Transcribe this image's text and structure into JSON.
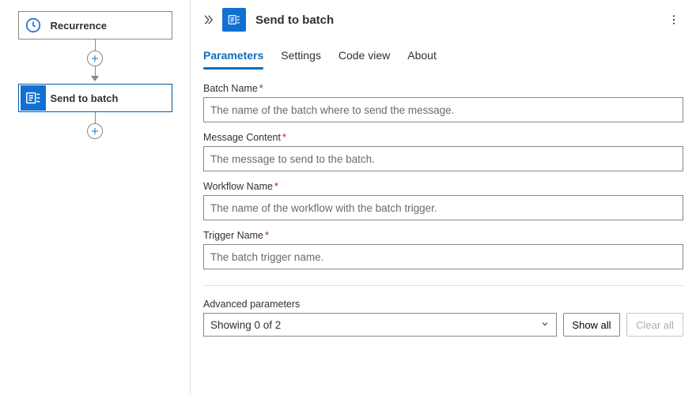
{
  "canvas": {
    "nodes": [
      {
        "label": "Recurrence",
        "icon": "recurrence-icon"
      },
      {
        "label": "Send to batch",
        "icon": "batch-icon"
      }
    ]
  },
  "panel": {
    "title": "Send to batch",
    "tabs": [
      "Parameters",
      "Settings",
      "Code view",
      "About"
    ],
    "active_tab": 0,
    "fields": [
      {
        "label": "Batch Name",
        "required": true,
        "placeholder": "The name of the batch where to send the message."
      },
      {
        "label": "Message Content",
        "required": true,
        "placeholder": "The message to send to the batch."
      },
      {
        "label": "Workflow Name",
        "required": true,
        "placeholder": "The name of the workflow with the batch trigger."
      },
      {
        "label": "Trigger Name",
        "required": true,
        "placeholder": "The batch trigger name."
      }
    ],
    "advanced": {
      "label": "Advanced parameters",
      "showing": "Showing 0 of 2",
      "show_all": "Show all",
      "clear_all": "Clear all"
    }
  }
}
